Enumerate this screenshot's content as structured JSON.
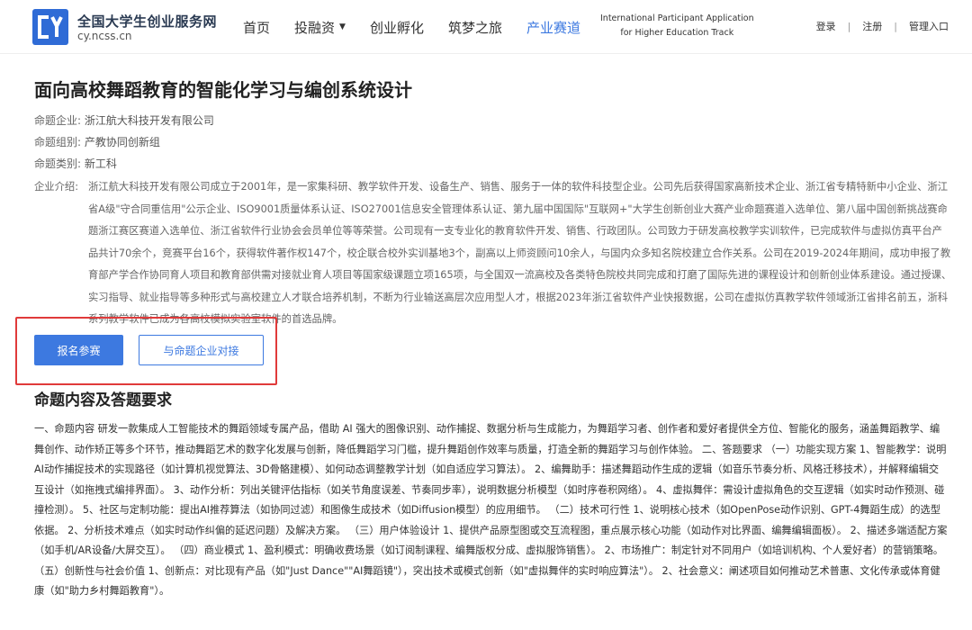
{
  "header": {
    "brand_name": "全国大学生创业服务网",
    "brand_url": "cy.ncss.cn",
    "nav": [
      {
        "label": "首页",
        "active": false,
        "dropdown": false
      },
      {
        "label": "投融资",
        "active": false,
        "dropdown": true
      },
      {
        "label": "创业孵化",
        "active": false,
        "dropdown": false
      },
      {
        "label": "筑梦之旅",
        "active": false,
        "dropdown": false
      },
      {
        "label": "产业赛道",
        "active": true,
        "dropdown": false
      }
    ],
    "track_line1": "International Participant Application",
    "track_line2": "for Higher Education Track",
    "login": "登录",
    "register": "注册",
    "admin": "管理入口",
    "separator": "|"
  },
  "page": {
    "title": "面向高校舞蹈教育的智能化学习与编创系统设计",
    "meta": [
      {
        "key": "命题企业:",
        "value": "浙江航大科技开发有限公司"
      },
      {
        "key": "命题组别:",
        "value": "产教协同创新组"
      },
      {
        "key": "命题类别:",
        "value": "新工科"
      }
    ],
    "intro_label": "企业介绍:",
    "intro_text": "浙江航大科技开发有限公司成立于2001年，是一家集科研、教学软件开发、设备生产、销售、服务于一体的软件科技型企业。公司先后获得国家高新技术企业、浙江省专精特新中小企业、浙江省A级\"守合同重信用\"公示企业、ISO9001质量体系认证、ISO27001信息安全管理体系认证、第九届中国国际\"互联网+\"大学生创新创业大赛产业命题赛道入选单位、第八届中国创新挑战赛命题浙江赛区赛道入选单位、浙江省软件行业协会会员单位等等荣誉。公司现有一支专业化的教育软件开发、销售、行政团队。公司致力于研发高校教学实训软件，已完成软件与虚拟仿真平台产品共计70余个，竞赛平台16个，获得软件著作权147个，校企联合校外实训基地3个，副高以上师资顾问10余人，与国内众多知名院校建立合作关系。公司在2019-2024年期间，成功申报了教育部产学合作协同育人项目和教育部供需对接就业育人项目等国家级课题立项165项，与全国双一流高校及各类特色院校共同完成和打磨了国际先进的课程设计和创新创业体系建设。通过授课、实习指导、就业指导等多种形式与高校建立人才联合培养机制，不断为行业输送高层次应用型人才，根据2023年浙江省软件产业快报数据，公司在虚拟仿真教学软件领域浙江省排名前五，浙科系列教学软件已成为各高校模拟实验室软件的首选品牌。",
    "btn_apply": "报名参赛",
    "btn_contact": "与命题企业对接",
    "section_title": "命题内容及答题要求",
    "content": "一、命题内容 研发一款集成人工智能技术的舞蹈领域专属产品，借助 AI 强大的图像识别、动作捕捉、数据分析与生成能力，为舞蹈学习者、创作者和爱好者提供全方位、智能化的服务，涵盖舞蹈教学、编舞创作、动作矫正等多个环节，推动舞蹈艺术的数字化发展与创新，降低舞蹈学习门槛，提升舞蹈创作效率与质量，打造全新的舞蹈学习与创作体验。 二、答题要求 （一）功能实现方案 1、智能教学：说明AI动作捕捉技术的实现路径（如计算机视觉算法、3D骨骼建模）、如何动态调整教学计划（如自适应学习算法）。 2、编舞助手：描述舞蹈动作生成的逻辑（如音乐节奏分析、风格迁移技术），并解释编辑交互设计（如拖拽式编排界面）。 3、动作分析：列出关键评估指标（如关节角度误差、节奏同步率），说明数据分析模型（如时序卷积网络）。 4、虚拟舞伴：需设计虚拟角色的交互逻辑（如实时动作预测、碰撞检测）。 5、社区与定制功能：提出AI推荐算法（如协同过滤）和图像生成技术（如Diffusion模型）的应用细节。 （二）技术可行性 1、说明核心技术（如OpenPose动作识别、GPT-4舞蹈生成）的选型依据。 2、分析技术难点（如实时动作纠偏的延迟问题）及解决方案。 （三）用户体验设计 1、提供产品原型图或交互流程图，重点展示核心功能（如动作对比界面、编舞编辑面板）。 2、描述多端适配方案（如手机/AR设备/大屏交互）。 （四）商业模式 1、盈利模式：明确收费场景（如订阅制课程、编舞版权分成、虚拟服饰销售）。 2、市场推广：制定针对不同用户（如培训机构、个人爱好者）的营销策略。 （五）创新性与社会价值 1、创新点：对比现有产品（如\"Just Dance\"\"AI舞蹈镜\"），突出技术或模式创新（如\"虚拟舞伴的实时响应算法\"）。 2、社会意义：阐述项目如何推动艺术普惠、文化传承或体育健康（如\"助力乡村舞蹈教育\"）。"
  },
  "colors": {
    "accent": "#3d79e0",
    "highlight_border": "#e03a3a",
    "logo_bg": "#2f6bd6"
  },
  "icons": {
    "logo": "cy-logo-icon",
    "caret": "chevron-down-icon"
  }
}
